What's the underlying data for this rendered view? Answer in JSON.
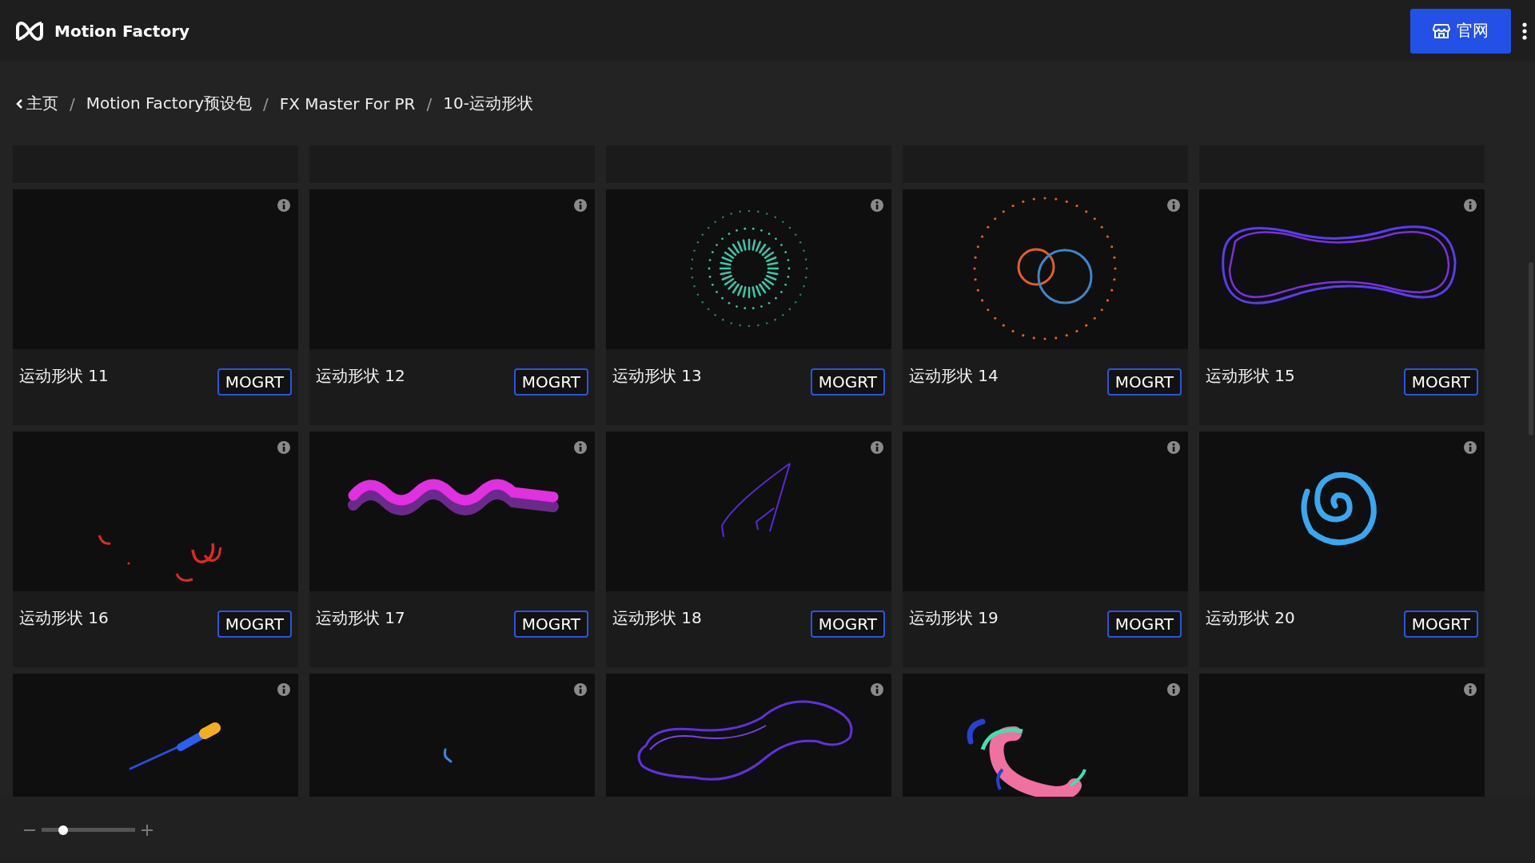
{
  "header": {
    "app_name": "Motion Factory",
    "site_button": "官网"
  },
  "breadcrumb": [
    {
      "label": "主页"
    },
    {
      "separator": "/",
      "label": "Motion Factory预设包"
    },
    {
      "separator": "/",
      "label": "FX Master For PR"
    },
    {
      "separator": "/",
      "label": "10-运动形状"
    }
  ],
  "cards": [
    {
      "kind": "cut"
    },
    {
      "kind": "cut"
    },
    {
      "kind": "cut"
    },
    {
      "kind": "cut"
    },
    {
      "kind": "cut"
    },
    {
      "kind": "empty",
      "title": "运动形状 11",
      "button": "MOGRT"
    },
    {
      "kind": "empty",
      "title": "运动形状 12",
      "button": "MOGRT"
    },
    {
      "kind": "picture",
      "title": "运动形状 13",
      "button": "MOGRT"
    },
    {
      "kind": "picture",
      "title": "运动形状 14",
      "button": "MOGRT"
    },
    {
      "kind": "picture",
      "title": "运动形状 15",
      "button": "MOGRT"
    },
    {
      "kind": "picture",
      "title": "运动形状 16",
      "button": "MOGRT"
    },
    {
      "kind": "picture",
      "title": "运动形状 17",
      "button": "MOGRT"
    },
    {
      "kind": "picture",
      "title": "运动形状 18",
      "button": "MOGRT"
    },
    {
      "kind": "empty",
      "title": "运动形状 19",
      "button": "MOGRT"
    },
    {
      "kind": "picture",
      "title": "运动形状 20",
      "button": "MOGRT"
    },
    {
      "kind": "picture"
    },
    {
      "kind": "picture"
    },
    {
      "kind": "picture"
    },
    {
      "kind": "picture"
    },
    {
      "kind": "empty"
    }
  ],
  "zoom_slider": {
    "level": 0.23
  }
}
